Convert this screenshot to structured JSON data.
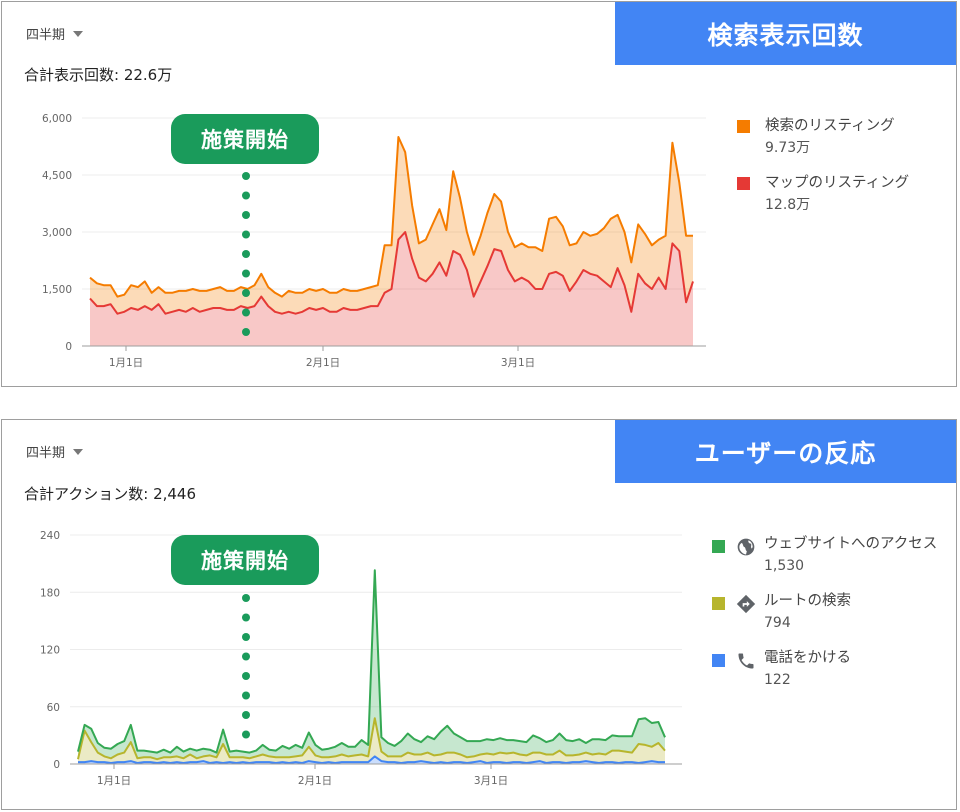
{
  "panel1": {
    "banner": "検索表示回数",
    "period": "四半期",
    "total": "合計表示回数: 22.6万",
    "marker": "施策開始",
    "legend": [
      {
        "label": "検索のリスティング",
        "value": "9.73万",
        "color": "#f57c00"
      },
      {
        "label": "マップのリスティング",
        "value": "12.8万",
        "color": "#e53935"
      }
    ]
  },
  "panel2": {
    "banner": "ユーザーの反応",
    "period": "四半期",
    "total": "合計アクション数: 2,446",
    "marker": "施策開始",
    "legend": [
      {
        "label": "ウェブサイトへのアクセス",
        "value": "1,530",
        "color": "#34a853",
        "icon": "globe-icon"
      },
      {
        "label": "ルートの検索",
        "value": "794",
        "color": "#b7b52d",
        "icon": "directions-icon"
      },
      {
        "label": "電話をかける",
        "value": "122",
        "color": "#4285f4",
        "icon": "phone-icon"
      }
    ]
  },
  "chart_data": [
    {
      "type": "area",
      "title": "検索表示回数",
      "stacked": true,
      "x_tick_labels": [
        "1月1日",
        "2月1日",
        "3月1日"
      ],
      "y_ticks": [
        "0",
        "1,500",
        "3,000",
        "4,500",
        "6,000"
      ],
      "ylim": [
        0,
        6000
      ],
      "annotation": "施策開始",
      "series": [
        {
          "name": "マップのリスティング",
          "color": "#e53935",
          "values": [
            1250,
            1050,
            1050,
            1100,
            850,
            900,
            1000,
            950,
            1050,
            950,
            1100,
            850,
            900,
            950,
            900,
            1000,
            900,
            950,
            1000,
            1000,
            950,
            950,
            1050,
            1000,
            1050,
            1300,
            1050,
            900,
            850,
            900,
            850,
            900,
            1000,
            950,
            1000,
            900,
            900,
            1000,
            950,
            950,
            1000,
            1050,
            1050,
            1400,
            1500,
            2800,
            3000,
            2300,
            1800,
            1700,
            1900,
            2200,
            1850,
            2500,
            2400,
            2000,
            1300,
            1700,
            2100,
            2550,
            2500,
            2000,
            1700,
            1800,
            1700,
            1500,
            1500,
            1900,
            1950,
            1850,
            1450,
            1700,
            2000,
            1900,
            1850,
            1700,
            1550,
            2050,
            1600,
            900,
            1900,
            1650,
            1500,
            1800,
            1500,
            2700,
            2500,
            1150,
            1700
          ]
        },
        {
          "name": "検索のリスティング",
          "color": "#f57c00",
          "values": [
            550,
            600,
            550,
            500,
            450,
            450,
            600,
            600,
            650,
            450,
            450,
            550,
            500,
            500,
            550,
            500,
            550,
            500,
            500,
            550,
            500,
            500,
            500,
            500,
            550,
            600,
            500,
            500,
            450,
            550,
            550,
            500,
            500,
            500,
            500,
            500,
            500,
            500,
            500,
            500,
            500,
            500,
            550,
            1250,
            1150,
            2700,
            2100,
            1400,
            900,
            1100,
            1300,
            1400,
            1200,
            2100,
            1500,
            1000,
            1100,
            1200,
            1400,
            1450,
            1300,
            1000,
            900,
            900,
            900,
            1100,
            1000,
            1450,
            1450,
            1300,
            1200,
            1000,
            1000,
            1000,
            1100,
            1400,
            1800,
            1400,
            1400,
            1300,
            1300,
            1300,
            1150,
            1000,
            1400,
            2650,
            1800,
            1750,
            1200
          ]
        }
      ]
    },
    {
      "type": "area",
      "title": "ユーザーの反応",
      "stacked": true,
      "x_tick_labels": [
        "1月1日",
        "2月1日",
        "3月1日"
      ],
      "y_ticks": [
        "0",
        "60",
        "120",
        "180",
        "240"
      ],
      "ylim": [
        0,
        240
      ],
      "annotation": "施策開始",
      "series": [
        {
          "name": "電話をかける",
          "color": "#4285f4",
          "values": [
            2,
            2,
            3,
            2,
            2,
            1,
            2,
            2,
            3,
            1,
            2,
            2,
            1,
            2,
            1,
            2,
            1,
            2,
            2,
            3,
            1,
            2,
            1,
            2,
            1,
            2,
            1,
            2,
            2,
            2,
            1,
            2,
            1,
            2,
            1,
            3,
            2,
            1,
            2,
            1,
            2,
            2,
            2,
            2,
            2,
            8,
            3,
            2,
            2,
            1,
            2,
            2,
            3,
            2,
            1,
            2,
            1,
            2,
            2,
            1,
            2,
            3,
            1,
            2,
            2,
            1,
            2,
            2,
            1,
            2,
            3,
            1,
            2,
            2,
            1,
            2,
            2,
            3,
            2,
            1,
            2,
            2,
            1,
            2,
            2,
            1,
            2,
            3,
            2,
            2
          ]
        },
        {
          "name": "ルートの検索",
          "color": "#b7b52d",
          "values": [
            3,
            33,
            20,
            10,
            6,
            5,
            8,
            10,
            20,
            5,
            5,
            5,
            4,
            5,
            6,
            6,
            5,
            8,
            4,
            5,
            8,
            5,
            20,
            5,
            6,
            5,
            5,
            6,
            8,
            6,
            6,
            5,
            6,
            6,
            8,
            15,
            7,
            6,
            5,
            7,
            8,
            6,
            7,
            8,
            6,
            40,
            10,
            6,
            6,
            7,
            10,
            8,
            7,
            10,
            8,
            8,
            11,
            10,
            8,
            6,
            6,
            7,
            10,
            8,
            10,
            10,
            10,
            8,
            8,
            10,
            9,
            9,
            8,
            12,
            8,
            7,
            8,
            9,
            8,
            10,
            8,
            12,
            13,
            11,
            10,
            20,
            18,
            15,
            20,
            12
          ]
        },
        {
          "name": "ウェブサイトへのアクセス",
          "color": "#34a853",
          "values": [
            8,
            6,
            14,
            10,
            9,
            10,
            11,
            12,
            18,
            8,
            7,
            6,
            7,
            8,
            5,
            10,
            7,
            6,
            8,
            8,
            6,
            5,
            15,
            6,
            7,
            6,
            6,
            6,
            10,
            7,
            7,
            12,
            9,
            12,
            8,
            15,
            11,
            8,
            9,
            10,
            12,
            10,
            9,
            15,
            12,
            155,
            15,
            14,
            11,
            16,
            20,
            16,
            13,
            17,
            17,
            24,
            28,
            20,
            18,
            17,
            16,
            14,
            15,
            15,
            15,
            14,
            13,
            14,
            14,
            18,
            15,
            13,
            15,
            18,
            16,
            15,
            16,
            10,
            16,
            15,
            15,
            16,
            15,
            16,
            17,
            26,
            28,
            25,
            22,
            14
          ]
        }
      ]
    }
  ]
}
